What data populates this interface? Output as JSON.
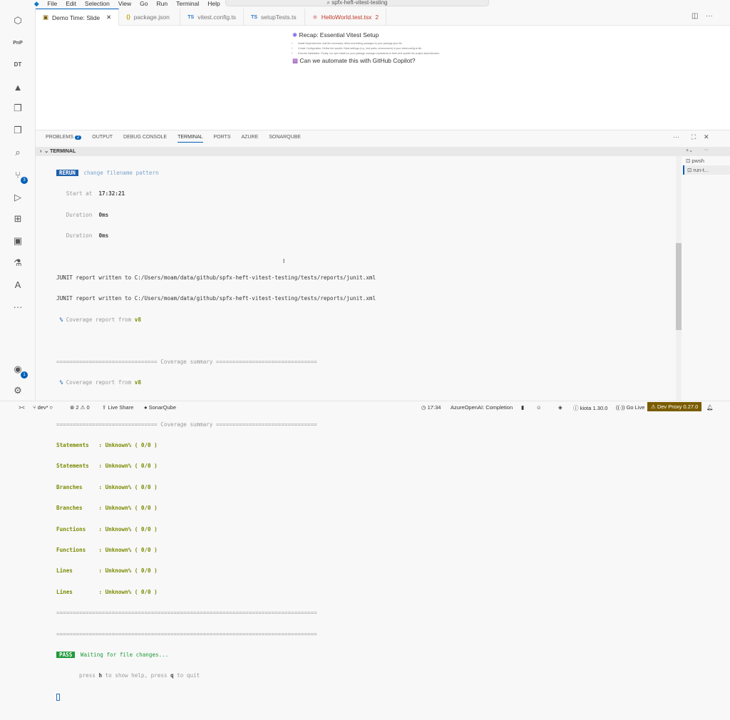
{
  "titlebar": {
    "menu": [
      "File",
      "Edit",
      "Selection",
      "View",
      "Go",
      "Run",
      "Terminal",
      "Help"
    ],
    "search": "spfx-heft-vitest-testing"
  },
  "tabs": [
    {
      "label": "Demo Time: Slide",
      "icon": "slide-icon",
      "active": true
    },
    {
      "label": "package.json",
      "icon": "{}"
    },
    {
      "label": "vitest.config.ts",
      "icon": "TS"
    },
    {
      "label": "setupTests.ts",
      "icon": "TS"
    },
    {
      "label": "HelloWorld.test.tsx",
      "badge": "2",
      "icon": "react-icon"
    }
  ],
  "slide": {
    "title": "Recap: Essential Vitest Setup",
    "bullets": [
      "Install Dependencies: Add the necessary Vitest and testing packages to your package.json file.",
      "Create Configuration: Define the specific Vitest settings (e.g., test paths, environment) in your vitest.config.ts file.",
      "Execute Installation: Finally, run npm install (or your package manager equivalent) to fetch and update the project dependencies."
    ],
    "question": "Can we automate this with GitHub Copilot?"
  },
  "panel": {
    "tabs": [
      "PROBLEMS",
      "OUTPUT",
      "DEBUG CONSOLE",
      "TERMINAL",
      "PORTS",
      "AZURE",
      "SONARQUBE"
    ],
    "problems_count": "2",
    "section": "TERMINAL",
    "terminals": [
      "pwsh",
      "run-t..."
    ]
  },
  "terminal": {
    "rerun": "RERUN",
    "rerun_text": " change filename pattern",
    "start_label": "   Start at  ",
    "start_value": "17:32:21",
    "dur_label": "   Duration  ",
    "dur_value": "0ms",
    "junit": "JUNIT report written to C:/Users/moam/data/github/spfx-heft-vitest-testing/tests/reports/junit.xml",
    "cov_pct": " %",
    "cov_text": " Coverage report from ",
    "cov_v8": "v8",
    "summary": "=============================== Coverage summary ===============================",
    "stats": [
      "Statements   : Unknown% ( 0/0 )",
      "Statements   : Unknown% ( 0/0 )",
      "Branches     : Unknown% ( 0/0 )",
      "Branches     : Unknown% ( 0/0 )",
      "Functions    : Unknown% ( 0/0 )",
      "Functions    : Unknown% ( 0/0 )",
      "Lines        : Unknown% ( 0/0 )",
      "Lines        : Unknown% ( 0/0 )"
    ],
    "sep": "================================================================================",
    "pass": "PASS",
    "waiting": " Waiting for file changes...",
    "help": [
      "       press ",
      "h",
      " to show help, press ",
      "q",
      " to quit"
    ]
  },
  "status": {
    "branch": "dev*",
    "errors": "2",
    "warnings": "0",
    "liveshare": "Live Share",
    "sonar": "SonarQube",
    "time": "17:34",
    "azure": "AzureOpenAI: Completion",
    "kiota": "kiota 1.30.0",
    "golive": "Go Live",
    "devproxy": "Dev Proxy 0.27.0"
  },
  "colors": {
    "accent": "#005fb8",
    "devproxy": "#7a5c00",
    "coverage": "#7a8a00",
    "pass": "#1f9a3a"
  }
}
